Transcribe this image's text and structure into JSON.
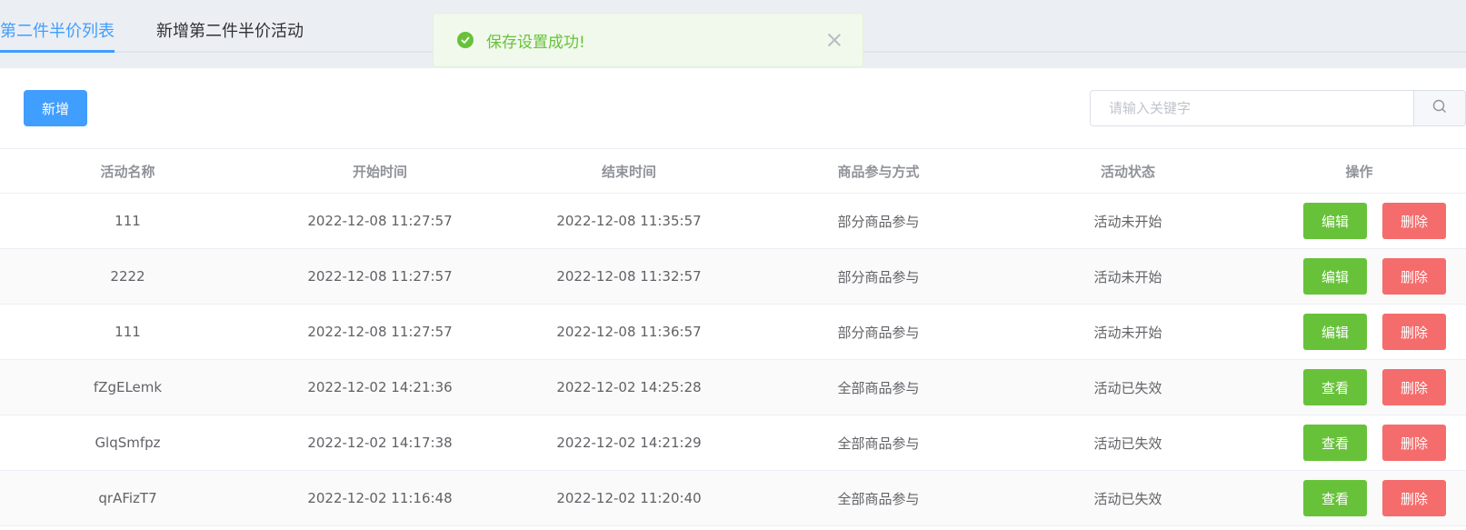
{
  "tabs": [
    {
      "label": "第二件半价列表",
      "active": true
    },
    {
      "label": "新增第二件半价活动",
      "active": false
    }
  ],
  "toast": {
    "message": "保存设置成功!",
    "icon": "check-circle-icon",
    "color": "#67c23a"
  },
  "toolbar": {
    "add_label": "新增",
    "search_placeholder": "请输入关键字",
    "search_value": ""
  },
  "table": {
    "headers": [
      "活动名称",
      "开始时间",
      "结束时间",
      "商品参与方式",
      "活动状态",
      "操作"
    ],
    "rows": [
      {
        "name": "111",
        "start": "2022-12-08 11:27:57",
        "end": "2022-12-08 11:35:57",
        "mode": "部分商品参与",
        "status": "活动未开始",
        "action": "编辑",
        "delete": "删除"
      },
      {
        "name": "2222",
        "start": "2022-12-08 11:27:57",
        "end": "2022-12-08 11:32:57",
        "mode": "部分商品参与",
        "status": "活动未开始",
        "action": "编辑",
        "delete": "删除"
      },
      {
        "name": "111",
        "start": "2022-12-08 11:27:57",
        "end": "2022-12-08 11:36:57",
        "mode": "部分商品参与",
        "status": "活动未开始",
        "action": "编辑",
        "delete": "删除"
      },
      {
        "name": "fZgELemk",
        "start": "2022-12-02 14:21:36",
        "end": "2022-12-02 14:25:28",
        "mode": "全部商品参与",
        "status": "活动已失效",
        "action": "查看",
        "delete": "删除"
      },
      {
        "name": "GlqSmfpz",
        "start": "2022-12-02 14:17:38",
        "end": "2022-12-02 14:21:29",
        "mode": "全部商品参与",
        "status": "活动已失效",
        "action": "查看",
        "delete": "删除"
      },
      {
        "name": "qrAFizT7",
        "start": "2022-12-02 11:16:48",
        "end": "2022-12-02 11:20:40",
        "mode": "全部商品参与",
        "status": "活动已失效",
        "action": "查看",
        "delete": "删除"
      }
    ]
  },
  "colors": {
    "primary": "#409eff",
    "success": "#67c23a",
    "danger": "#f56c6c"
  }
}
